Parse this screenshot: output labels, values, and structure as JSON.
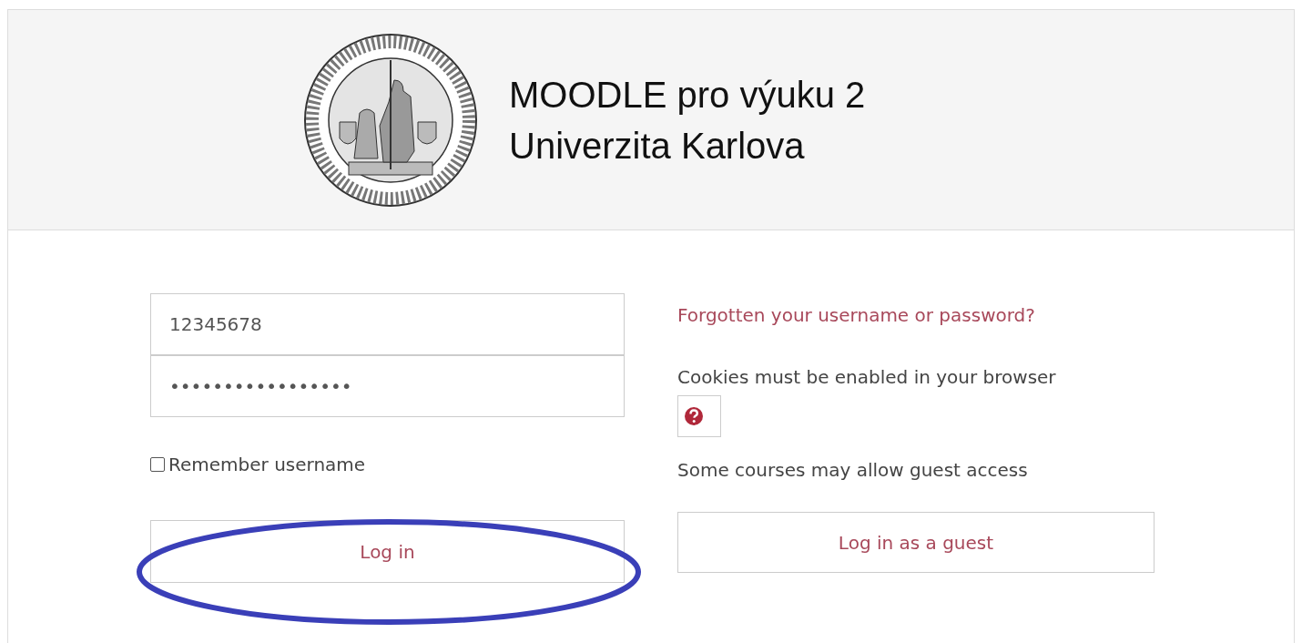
{
  "header": {
    "title_lines": [
      "MOODLE pro výuku 2",
      "Univerzita Karlova"
    ]
  },
  "login_form": {
    "username": {
      "value": "12345678"
    },
    "password": {
      "value": "•••••••••••••••••"
    },
    "remember_username": {
      "label": "Remember username",
      "checked": false
    },
    "login_button": {
      "label": "Log in"
    }
  },
  "guest_panel": {
    "forgot_link": "Forgotten your username or password?",
    "cookies_notice": "Cookies must be enabled in your browser",
    "guest_notice": "Some courses may allow guest access",
    "guest_button": {
      "label": "Log in as a guest"
    }
  },
  "annotations": [
    {
      "kind": "ellipse"
    }
  ]
}
